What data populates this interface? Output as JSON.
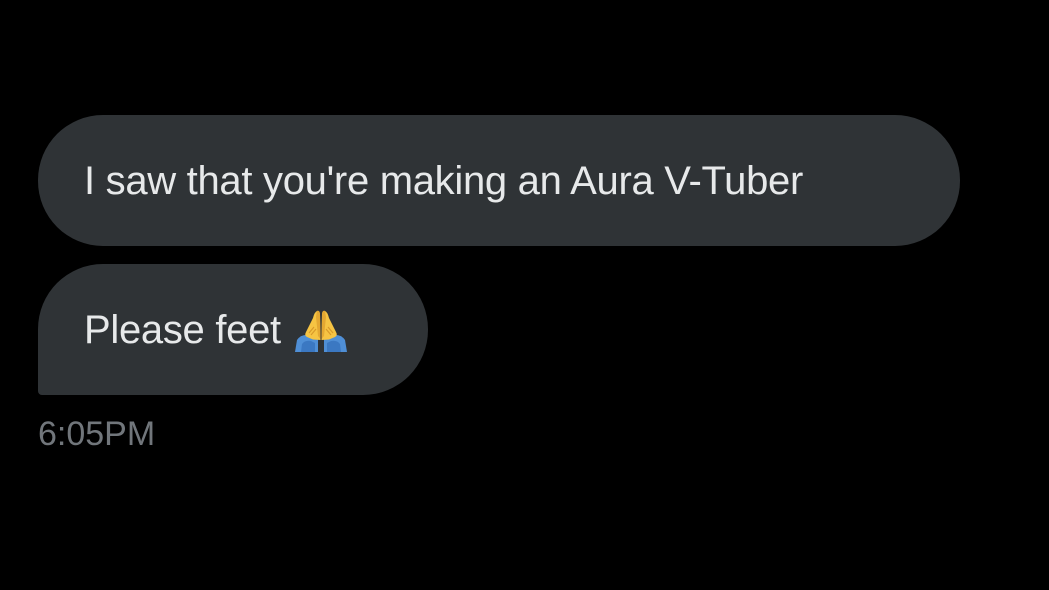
{
  "conversation": {
    "messages": [
      {
        "text": "I saw that you're making an Aura V-Tuber"
      },
      {
        "text": "Please feet",
        "emoji": "folded-hands-emoji"
      }
    ],
    "timestamp": "6:05PM"
  },
  "colors": {
    "background": "#000000",
    "bubble": "#2f3336",
    "message_text": "#e7e9ea",
    "timestamp_text": "#71767b"
  }
}
